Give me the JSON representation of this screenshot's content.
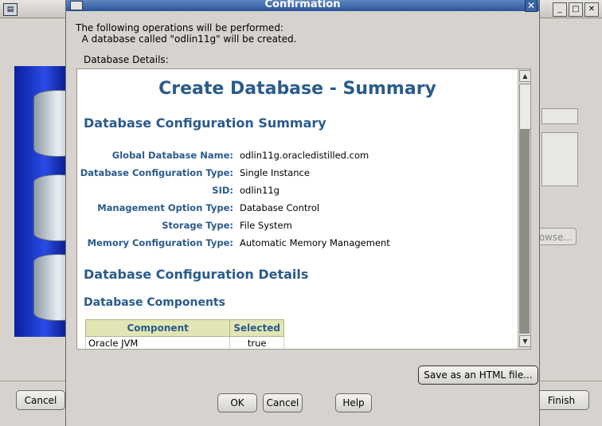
{
  "background_window": {
    "app_icon": "database-window-icon",
    "controls": [
      "_",
      "□",
      "✕"
    ],
    "browse_label": "owse...",
    "cancel_label": "Cancel",
    "finish_label": "Finish"
  },
  "dialog": {
    "title": "Confirmation",
    "close_icon": "✕",
    "intro_line1": "The following operations will be performed:",
    "intro_line2": "  A database called \"odlin11g\" will be created.",
    "details_label": "Database Details:",
    "summary_title": "Create Database - Summary",
    "config_summary_heading": "Database Configuration Summary",
    "summary_rows": [
      {
        "label": "Global Database Name:",
        "value": "odlin11g.oracledistilled.com"
      },
      {
        "label": "Database Configuration Type:",
        "value": "Single Instance"
      },
      {
        "label": "SID:",
        "value": "odlin11g"
      },
      {
        "label": "Management Option Type:",
        "value": "Database Control"
      },
      {
        "label": "Storage Type:",
        "value": "File System"
      },
      {
        "label": "Memory Configuration Type:",
        "value": "Automatic Memory Management"
      }
    ],
    "config_details_heading": "Database Configuration Details",
    "components_heading": "Database Components",
    "components_table": {
      "headers": [
        "Component",
        "Selected"
      ],
      "rows": [
        [
          "Oracle JVM",
          "true"
        ]
      ]
    },
    "save_button": "Save as an HTML file...",
    "ok_button": "OK",
    "cancel_button": "Cancel",
    "help_button": "Help"
  },
  "colors": {
    "title_bar": "#2c5699",
    "heading_blue": "#2a5b8c",
    "table_header": "#e2e6b5"
  }
}
